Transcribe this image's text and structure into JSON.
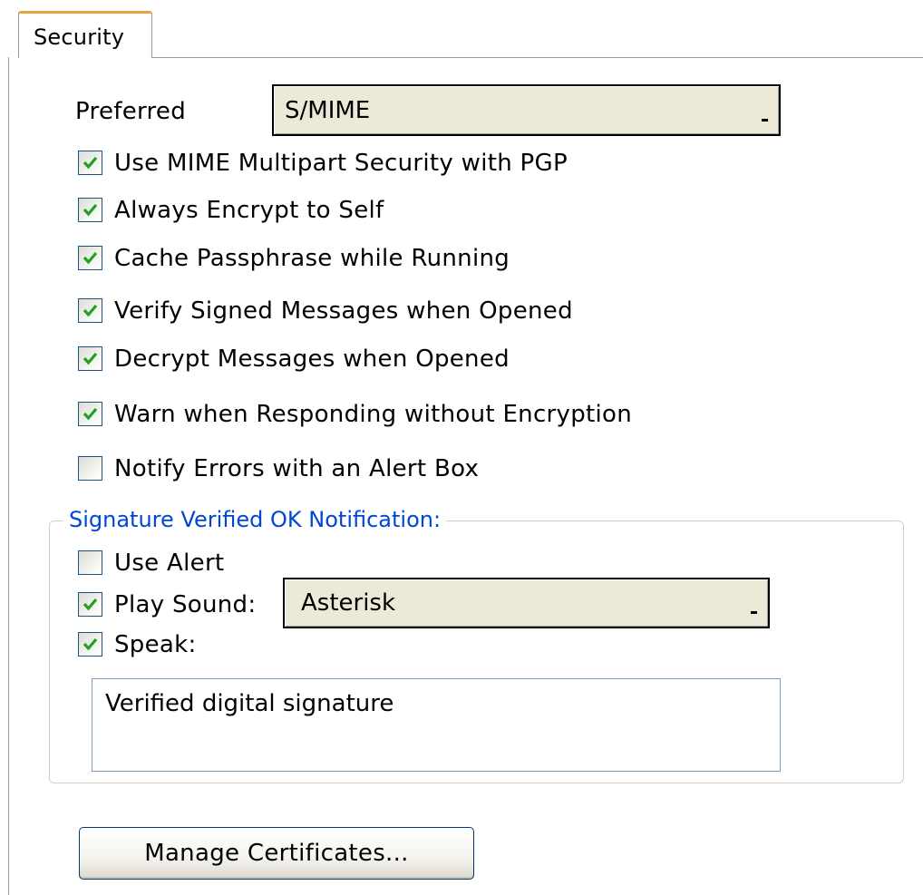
{
  "tab": {
    "label": "Security"
  },
  "preferred": {
    "label": "Preferred",
    "value": "S/MIME"
  },
  "options": [
    {
      "label": "Use MIME Multipart Security with PGP",
      "checked": true
    },
    {
      "label": "Always Encrypt to Self",
      "checked": true
    },
    {
      "label": "Cache Passphrase while Running",
      "checked": true
    },
    {
      "label": "Verify Signed Messages when Opened",
      "checked": true
    },
    {
      "label": "Decrypt Messages when Opened",
      "checked": true
    },
    {
      "label": "Warn when Responding without Encryption",
      "checked": true
    },
    {
      "label": "Notify Errors with an Alert Box",
      "checked": false
    }
  ],
  "notification": {
    "title": "Signature Verified OK Notification:",
    "use_alert": {
      "label": "Use Alert",
      "checked": false
    },
    "play_sound": {
      "label": "Play Sound:",
      "checked": true,
      "value": "Asterisk"
    },
    "speak": {
      "label": "Speak:",
      "checked": true
    },
    "speak_text": "Verified digital signature"
  },
  "manage_button": {
    "label": "Manage Certificates..."
  },
  "colors": {
    "tab_accent": "#e8a438",
    "check": "#21a121",
    "group_title": "#0046d5",
    "dropdown_bg": "#ece9d8"
  }
}
